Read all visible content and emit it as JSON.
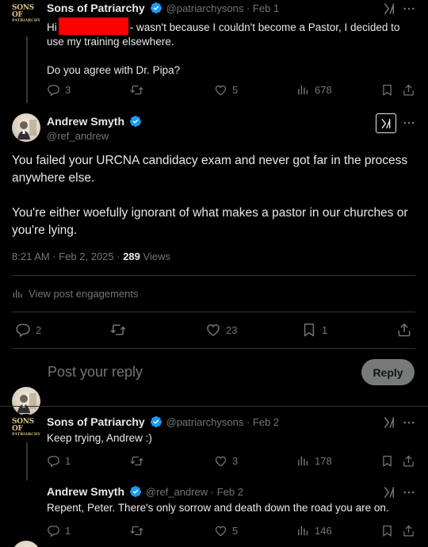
{
  "posts": {
    "p1": {
      "name": "Sons of Patriarchy",
      "handle": "@patriarchysons",
      "date": "Feb 1",
      "text_pre": "Hi",
      "text_post": "- wasn't because I couldn't become a Pastor, I decided to",
      "text_line2": "use my training elsewhere.",
      "text_line3": "Do you agree with Dr. Pipa?",
      "replies": "3",
      "reposts": "",
      "likes": "5",
      "views": "678"
    },
    "main": {
      "name": "Andrew Smyth",
      "handle": "@ref_andrew",
      "text_p1": "You failed your URCNA candidacy exam and never got far in the process anywhere else.",
      "text_p2": "You're either woefully ignorant of what makes a pastor in our churches or you're lying.",
      "time": "8:21 AM · Feb 2, 2025 · ",
      "views": "289",
      "views_label": " Views",
      "engagements": "View post engagements",
      "replies": "2",
      "reposts": "",
      "likes": "23",
      "bookmarks": "1"
    },
    "compose": {
      "placeholder": "Post your reply",
      "button": "Reply"
    },
    "p2": {
      "name": "Sons of Patriarchy",
      "handle": "@patriarchysons",
      "date": "Feb 2",
      "text": "Keep trying, Andrew :)",
      "replies": "1",
      "reposts": "",
      "likes": "3",
      "views": "178"
    },
    "p3": {
      "name": "Andrew Smyth",
      "handle": "@ref_andrew",
      "date": "Feb 2",
      "text": "Repent, Peter. There's only sorrow and death down the road you are on.",
      "replies": "1",
      "reposts": "",
      "likes": "5",
      "views": "146"
    }
  },
  "logo": {
    "line1": "SONS OF",
    "line2": "PATRIARCHY"
  },
  "sep": " · ",
  "colors": {
    "verified": "#1d9bf0",
    "bg": "#000000",
    "muted": "#71767b",
    "redaction": "#ff0000"
  }
}
